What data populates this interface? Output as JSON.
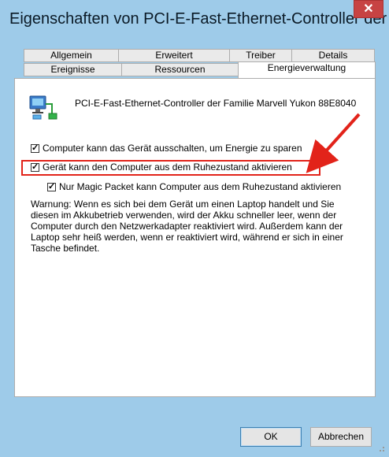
{
  "window": {
    "title": "Eigenschaften von PCI-E-Fast-Ethernet-Controller der ...",
    "close_label": "✕"
  },
  "tabs": {
    "row1": [
      "Allgemein",
      "Erweitert",
      "Treiber",
      "Details"
    ],
    "row2": [
      "Ereignisse",
      "Ressourcen",
      "Energieverwaltung"
    ],
    "active": "Energieverwaltung"
  },
  "panel": {
    "device_icon": "network-adapter-icon",
    "device_name": "PCI-E-Fast-Ethernet-Controller der Familie Marvell Yukon 88E8040",
    "options": [
      {
        "label": "Computer kann das Gerät ausschalten, um Energie zu sparen",
        "checked": true
      },
      {
        "label": "Gerät kann den Computer aus dem Ruhezustand aktivieren",
        "checked": true
      },
      {
        "label": "Nur Magic Packet kann Computer aus dem Ruhezustand aktivieren",
        "checked": true
      }
    ],
    "warning": "Warnung: Wenn es sich bei dem Gerät um einen Laptop handelt und Sie diesen im Akkubetrieb verwenden, wird der Akku schneller leer, wenn der Computer durch den Netzwerkadapter reaktiviert wird. Außerdem kann der Laptop sehr heiß werden, wenn er reaktiviert wird, während er sich in einer Tasche befindet."
  },
  "buttons": {
    "ok": "OK",
    "cancel": "Abbrechen"
  },
  "colors": {
    "frame": "#9ecbe9",
    "annotation": "#e2231a"
  }
}
